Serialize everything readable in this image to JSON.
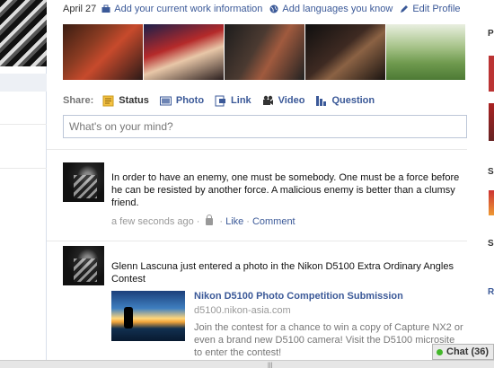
{
  "info_bar": {
    "date": "April 27",
    "work_link": "Add your current work information",
    "languages_link": "Add languages you know",
    "edit_profile": "Edit Profile"
  },
  "photos_count": 5,
  "share": {
    "label": "Share:",
    "items": [
      "Status",
      "Photo",
      "Link",
      "Video",
      "Question"
    ]
  },
  "status_input": {
    "placeholder": "What's on your mind?"
  },
  "stories": [
    {
      "text": "In order to have an enemy, one must be somebody. One must be a force before he can be resisted by another force. A malicious enemy is better than a clumsy friend.",
      "time": "a few seconds ago",
      "dot": "·",
      "like": "Like",
      "comment": "Comment"
    },
    {
      "text": "Glenn Lascuna just entered a photo in the Nikon D5100 Extra Ordinary Angles Contest",
      "attachment": {
        "title": "Nikon D5100 Photo Competition Submission",
        "domain": "d5100.nikon-asia.com",
        "description": "Join the contest for a chance to win a copy of Capture NX2 or even a brand new D5100 camera! Visit the D5100 microsite to enter the contest!"
      }
    }
  ],
  "right_col_letters": [
    "P",
    "S",
    "S",
    "R"
  ],
  "chat": {
    "label": "Chat (36)"
  },
  "colors": {
    "link": "#3b5998",
    "border": "#bdc7d8",
    "meta": "#999999"
  }
}
